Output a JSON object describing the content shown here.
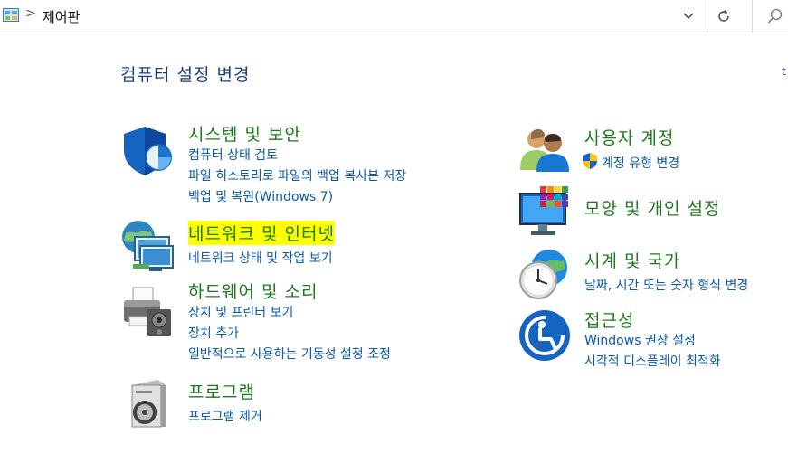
{
  "address_bar": {
    "breadcrumb_separator": ">",
    "location": "제어판"
  },
  "page_title": "컴퓨터 설정 변경",
  "view_by_partial": "t",
  "categories": [
    {
      "id": "system-security",
      "icon": "security-shield-icon",
      "title": "시스템 및 보안",
      "links": [
        "컴퓨터 상태 검토",
        "파일 히스토리로 파일의 백업 복사본 저장",
        "백업 및 복원(Windows 7)"
      ]
    },
    {
      "id": "network-internet",
      "icon": "network-globe-icon",
      "title": "네트워크 및 인터넷",
      "highlighted": true,
      "links": [
        "네트워크 상태 및 작업 보기"
      ]
    },
    {
      "id": "hardware-sound",
      "icon": "printer-speaker-icon",
      "title": "하드웨어 및 소리",
      "links": [
        "장치 및 프린터 보기",
        "장치 추가",
        "일반적으로 사용하는 기동성 설정 조정"
      ]
    },
    {
      "id": "programs",
      "icon": "programs-disc-icon",
      "title": "프로그램",
      "links": [
        "프로그램 제거"
      ]
    },
    {
      "id": "user-accounts",
      "icon": "users-icon",
      "title": "사용자 계정",
      "links": [
        "계정 유형 변경"
      ]
    },
    {
      "id": "appearance",
      "icon": "appearance-monitor-icon",
      "title": "모양 및 개인 설정",
      "links": []
    },
    {
      "id": "clock-region",
      "icon": "clock-globe-icon",
      "title": "시계 및 국가",
      "links": [
        "날짜, 시간 또는 숫자 형식 변경"
      ]
    },
    {
      "id": "ease-of-access",
      "icon": "ease-of-access-icon",
      "title": "접근성",
      "links": [
        "Windows 권장 설정",
        "시각적 디스플레이 최적화"
      ]
    }
  ],
  "colors": {
    "category_title": "#1e7a1e",
    "link": "#0a5aa8",
    "page_title": "#1c3e7c",
    "highlight": "#ffff00"
  }
}
